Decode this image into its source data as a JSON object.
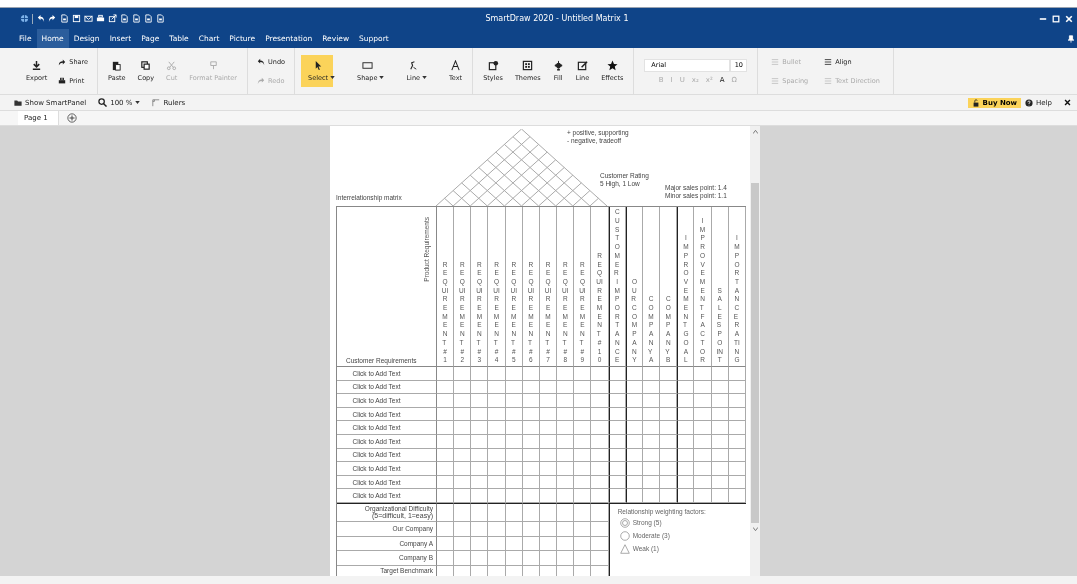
{
  "window": {
    "title": "SmartDraw 2020 - Untitled Matrix 1"
  },
  "menu": [
    {
      "label": "File",
      "selected": false
    },
    {
      "label": "Home",
      "selected": true
    },
    {
      "label": "Design",
      "selected": false
    },
    {
      "label": "Insert",
      "selected": false
    },
    {
      "label": "Page",
      "selected": false
    },
    {
      "label": "Table",
      "selected": false
    },
    {
      "label": "Chart",
      "selected": false
    },
    {
      "label": "Picture",
      "selected": false
    },
    {
      "label": "Presentation",
      "selected": false
    },
    {
      "label": "Review",
      "selected": false
    },
    {
      "label": "Support",
      "selected": false
    }
  ],
  "ribbon": [
    {
      "items": [
        {
          "kind": "large",
          "label": "Export",
          "disabled": false,
          "dropdown": false,
          "selected": false
        },
        {
          "kind": "small",
          "label": "Share",
          "disabled": false
        },
        {
          "kind": "small",
          "label": "Print",
          "disabled": false
        }
      ]
    },
    {
      "items": [
        {
          "kind": "large",
          "label": "Paste",
          "disabled": false,
          "dropdown": false,
          "selected": false
        },
        {
          "kind": "large",
          "label": "Copy",
          "disabled": false,
          "dropdown": false,
          "selected": false
        },
        {
          "kind": "large",
          "label": "Cut",
          "disabled": true,
          "dropdown": false,
          "selected": false
        },
        {
          "kind": "large",
          "label": "Format Painter",
          "disabled": true,
          "dropdown": false,
          "selected": false
        }
      ]
    },
    {
      "items": [
        {
          "kind": "small",
          "label": "Undo",
          "disabled": false
        },
        {
          "kind": "small",
          "label": "Redo",
          "disabled": true
        }
      ]
    },
    {
      "items": [
        {
          "kind": "large",
          "label": "Select",
          "disabled": false,
          "dropdown": true,
          "selected": true
        },
        {
          "kind": "large",
          "label": "Shape",
          "disabled": false,
          "dropdown": true,
          "selected": false
        },
        {
          "kind": "large",
          "label": "Line",
          "disabled": false,
          "dropdown": true,
          "selected": false
        },
        {
          "kind": "large",
          "label": "Text",
          "disabled": false,
          "dropdown": false,
          "selected": false
        }
      ]
    },
    {
      "items": [
        {
          "kind": "large",
          "label": "Styles",
          "disabled": false,
          "dropdown": false,
          "selected": false
        },
        {
          "kind": "large",
          "label": "Themes",
          "disabled": false,
          "dropdown": false,
          "selected": false
        },
        {
          "kind": "large",
          "label": "Fill",
          "disabled": false,
          "dropdown": false,
          "selected": false
        },
        {
          "kind": "large",
          "label": "Line",
          "disabled": false,
          "dropdown": false,
          "selected": false
        },
        {
          "kind": "large",
          "label": "Effects",
          "disabled": false,
          "dropdown": false,
          "selected": false
        }
      ]
    }
  ],
  "font": {
    "family": "Arial",
    "size": "10",
    "format_buttons": [
      {
        "label": "B",
        "disabled": true
      },
      {
        "label": "I",
        "disabled": true
      },
      {
        "label": "U",
        "disabled": true
      },
      {
        "label": "x₂",
        "disabled": true
      },
      {
        "label": "x²",
        "disabled": true
      },
      {
        "label": "A",
        "disabled": false
      },
      {
        "label": "Ω",
        "disabled": true
      }
    ]
  },
  "paragraph": [
    {
      "label": "Bullet",
      "disabled": true
    },
    {
      "label": "Spacing",
      "disabled": true
    },
    {
      "label": "Align",
      "disabled": false
    },
    {
      "label": "Text Direction",
      "disabled": true
    }
  ],
  "toolbar": {
    "smartpanel": "Show SmartPanel",
    "zoom": "100 %",
    "rulers": "Rulers",
    "buy": "Buy Now",
    "help": "Help"
  },
  "pages": [
    {
      "label": "Page 1",
      "selected": true
    }
  ],
  "matrix": {
    "interrelationship_label": "Interrelationship matrix",
    "legend": [
      "+ positive, supporting",
      "- negative, tradeoff"
    ],
    "rating_note": [
      "Customer Rating",
      "5 High, 1 Low"
    ],
    "sales_note": [
      "Major sales point: 1.4",
      "Minor sales point: 1.1"
    ],
    "axis_label": "Product Requirements",
    "corner_label": "Customer Requirements",
    "columns": [
      {
        "label": "REQUIREMENT #1",
        "kind": "requirement"
      },
      {
        "label": "REQUIREMENT #2",
        "kind": "requirement"
      },
      {
        "label": "REQUIREMENT #3",
        "kind": "requirement"
      },
      {
        "label": "REQUIREMENT #4",
        "kind": "requirement"
      },
      {
        "label": "REQUIREMENT #5",
        "kind": "requirement"
      },
      {
        "label": "REQUIREMENT #6",
        "kind": "requirement"
      },
      {
        "label": "REQUIREMENT #7",
        "kind": "requirement"
      },
      {
        "label": "REQUIREMENT #8",
        "kind": "requirement"
      },
      {
        "label": "REQUIREMENT #9",
        "kind": "requirement"
      },
      {
        "label": "REQUIREMENT #10",
        "kind": "requirement"
      },
      {
        "label": "CUSTOMER IMPORTANCE",
        "kind": "importance"
      },
      {
        "label": "OUR COMPANY",
        "kind": "rating"
      },
      {
        "label": "COMPANY A",
        "kind": "rating"
      },
      {
        "label": "COMPANY B",
        "kind": "rating"
      },
      {
        "label": "IMPROVEMENT GOAL",
        "kind": "improvement"
      },
      {
        "label": "IMPROVEMENT FACTOR",
        "kind": "improvement"
      },
      {
        "label": "SALES POINT",
        "kind": "improvement"
      },
      {
        "label": "IMPORTANCE RATING",
        "kind": "improvement"
      }
    ],
    "rows": [
      "Click to Add Text",
      "Click to Add Text",
      "Click to Add Text",
      "Click to Add Text",
      "Click to Add Text",
      "Click to Add Text",
      "Click to Add Text",
      "Click to Add Text",
      "Click to Add Text",
      "Click to Add Text"
    ],
    "footer_rows": [
      {
        "label": "Organizational Difficulty",
        "note": "(5=difficult, 1=easy)"
      },
      {
        "label": "Our Company"
      },
      {
        "label": "Company A"
      },
      {
        "label": "Company B"
      },
      {
        "label": "Target Benchmark"
      }
    ],
    "weighting": {
      "title": "Relationship weighting factors:",
      "items": [
        {
          "kind": "strong",
          "label": "Strong (5)"
        },
        {
          "kind": "moderate",
          "label": "Moderate (3)"
        },
        {
          "kind": "weak",
          "label": "Weak (1)"
        }
      ]
    }
  }
}
